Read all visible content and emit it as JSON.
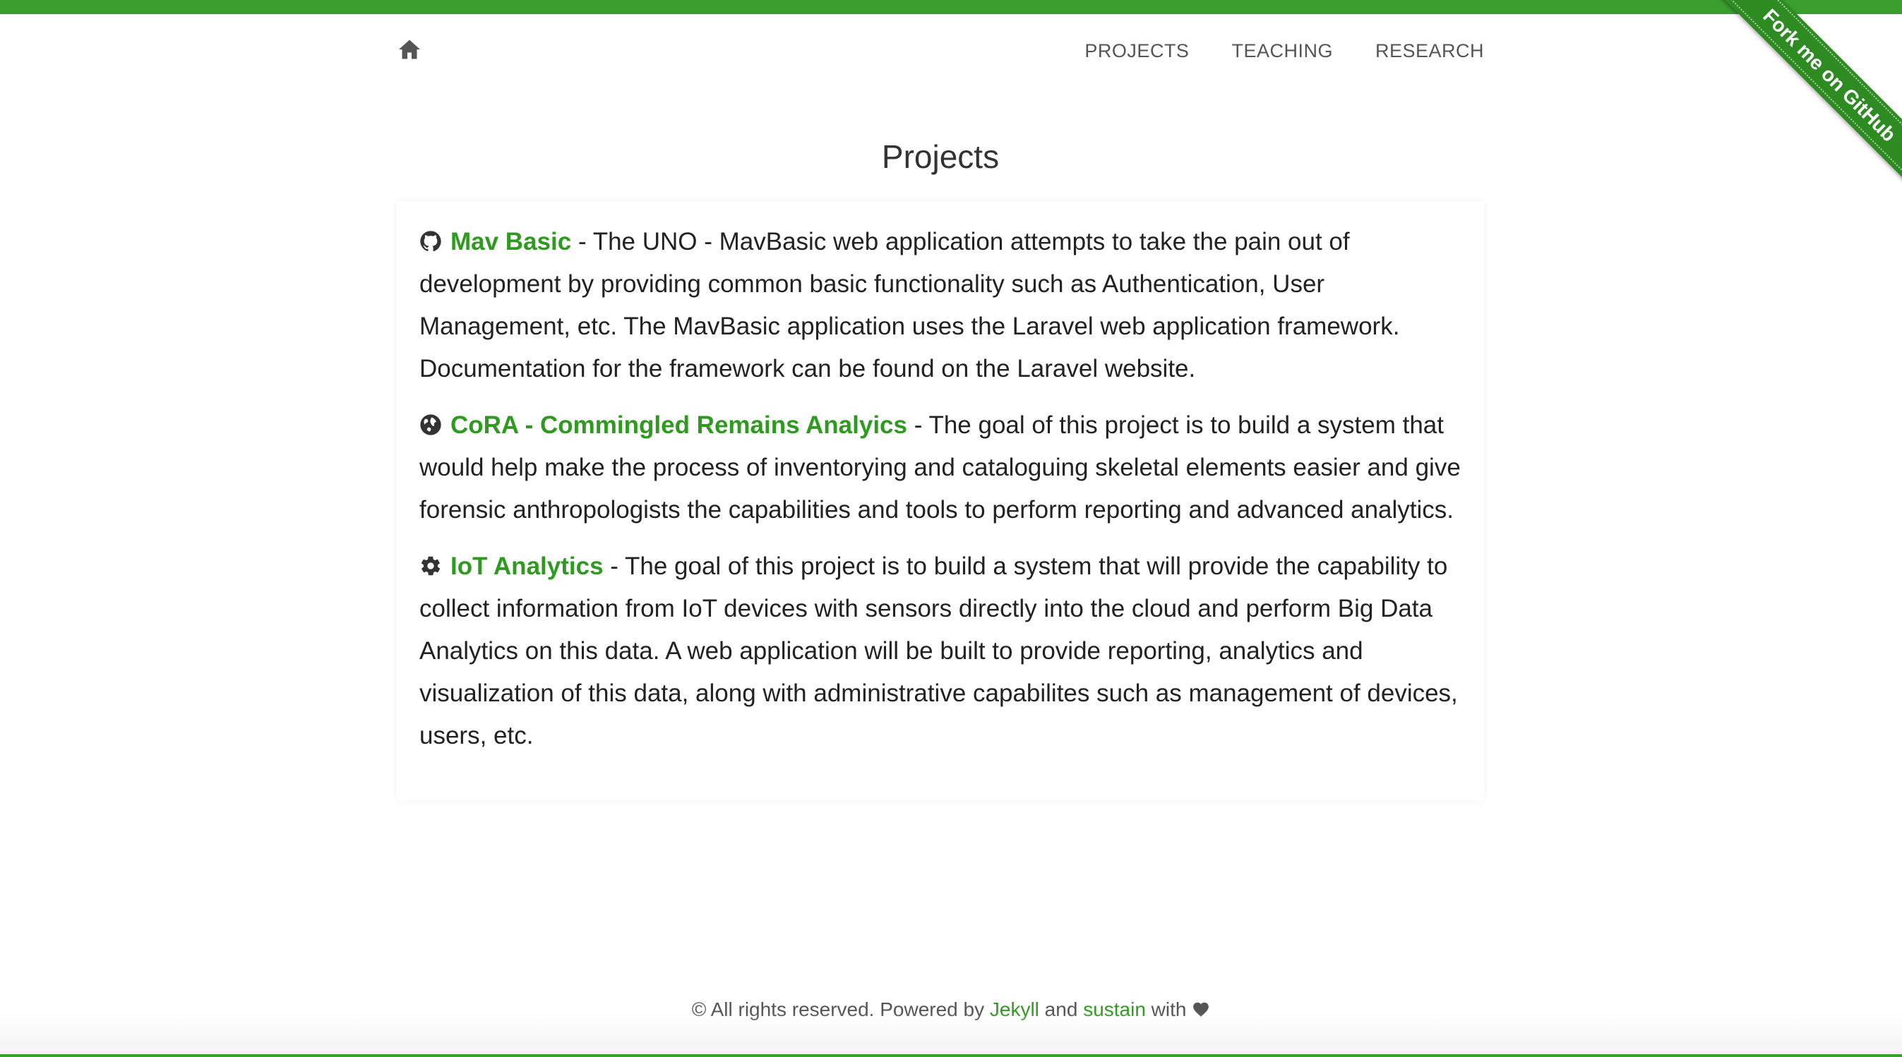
{
  "nav": {
    "home_icon": "home-icon",
    "links": [
      "PROJECTS",
      "TEACHING",
      "RESEARCH"
    ]
  },
  "ribbon": {
    "label": "Fork me on GitHub"
  },
  "page": {
    "title": "Projects"
  },
  "projects": [
    {
      "icon": "github-icon",
      "name": "Mav Basic",
      "description": " - The UNO - MavBasic web application attempts to take the pain out of development by providing common basic functionality such as Authentication, User Management, etc. The MavBasic application uses the Laravel web application framework. Documentation for the framework can be found on the Laravel website."
    },
    {
      "icon": "globe-icon",
      "name": "CoRA - Commingled Remains Analyics",
      "description": " - The goal of this project is to build a system that would help make the process of inventorying and cataloguing skeletal elements easier and give forensic anthropologists the capabilities and tools to perform reporting and advanced analytics."
    },
    {
      "icon": "gear-icon",
      "name": "IoT Analytics",
      "description": " - The goal of this project is to build a system that will provide the capability to collect information from IoT devices with sensors directly into the cloud and perform Big Data Analytics on this data. A web application will be built to provide reporting, analytics and visualization of this data, along with administrative capabilites such as management of devices, users, etc."
    }
  ],
  "footer": {
    "prefix": "© All rights reserved. Powered by ",
    "link1": "Jekyll",
    "middle": " and ",
    "link2": "sustain",
    "suffix": " with ",
    "icon": "heart-icon"
  },
  "colors": {
    "accent": "#3a9e2f",
    "link": "#2e9a1f",
    "text": "#222222",
    "nav": "#555555"
  }
}
